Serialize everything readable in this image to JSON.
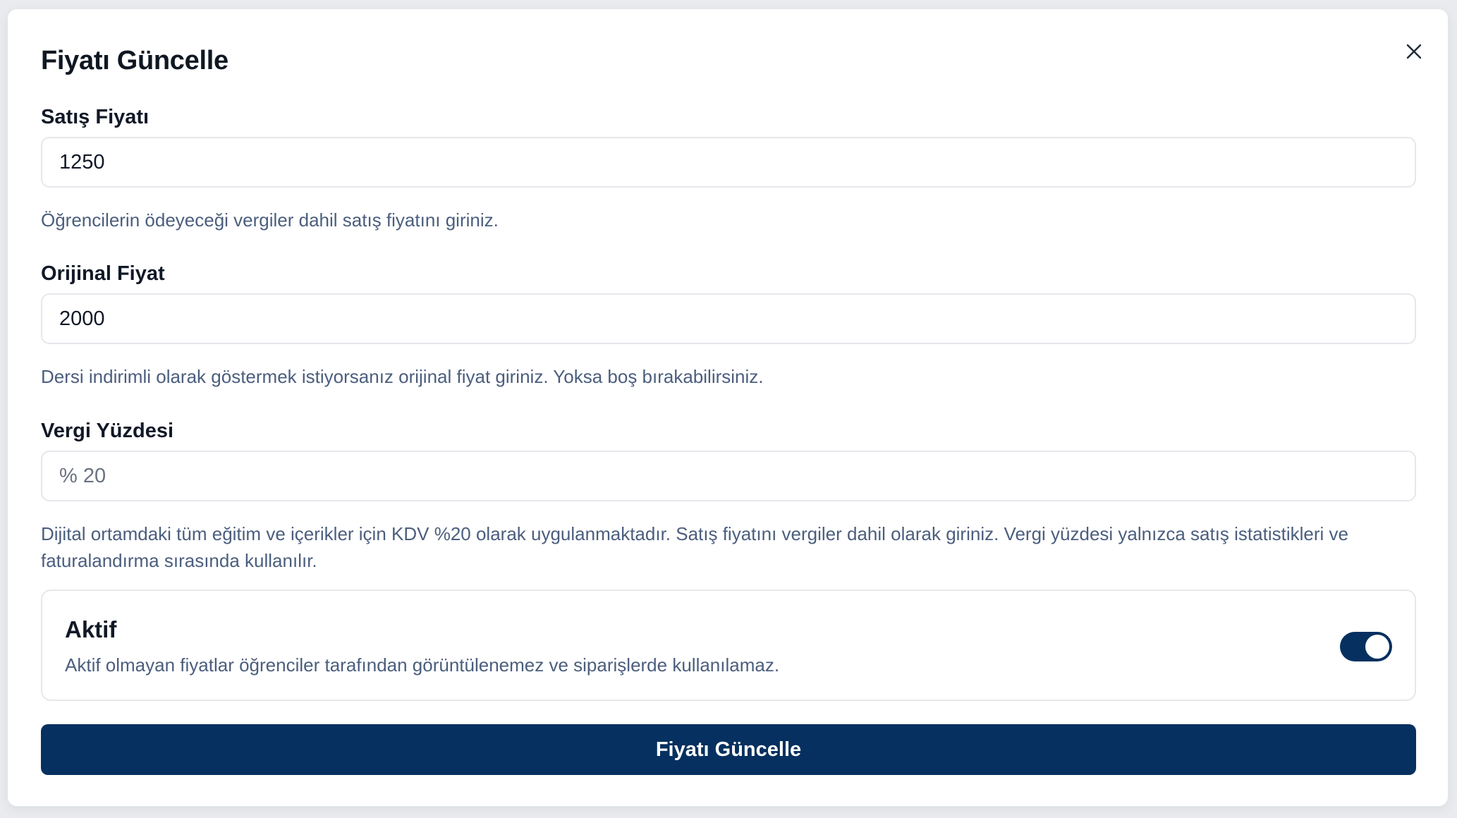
{
  "dialog": {
    "title": "Fiyatı Güncelle",
    "close_icon": "close-icon"
  },
  "fields": {
    "sale_price": {
      "label": "Satış Fiyatı",
      "value": "1250",
      "help": "Öğrencilerin ödeyeceği vergiler dahil satış fiyatını giriniz."
    },
    "original_price": {
      "label": "Orijinal Fiyat",
      "value": "2000",
      "help": "Dersi indirimli olarak göstermek istiyorsanız orijinal fiyat giriniz. Yoksa boş bırakabilirsiniz."
    },
    "tax_percent": {
      "label": "Vergi Yüzdesi",
      "placeholder": "% 20",
      "help": "Dijital ortamdaki tüm eğitim ve içerikler için KDV %20 olarak uygulanmaktadır. Satış fiyatını vergiler dahil olarak giriniz. Vergi yüzdesi yalnızca satış istatistikleri ve faturalandırma sırasında kullanılır."
    }
  },
  "active": {
    "title": "Aktif",
    "description": "Aktif olmayan fiyatlar öğrenciler tarafından görüntülenemez ve siparişlerde kullanılamaz.",
    "enabled": true
  },
  "submit_label": "Fiyatı Güncelle",
  "colors": {
    "primary": "#06305f",
    "help_text": "#4b5e7e",
    "border": "#e5e7eb"
  }
}
